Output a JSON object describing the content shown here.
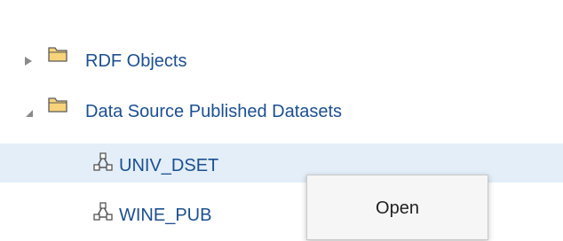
{
  "tree": {
    "items": [
      {
        "label": "RDF Objects",
        "icon": "folder-icon",
        "expanded": false
      },
      {
        "label": "Data Source Published Datasets",
        "icon": "folder-icon",
        "expanded": true
      },
      {
        "label": "UNIV_DSET",
        "icon": "dataset-icon",
        "selected": true
      },
      {
        "label": "WINE_PUB",
        "icon": "dataset-icon",
        "selected": false
      }
    ]
  },
  "context_menu": {
    "items": [
      {
        "label": "Open"
      }
    ]
  },
  "colors": {
    "link_text": "#1b4f93",
    "selection": "#e3eef8",
    "folder": "#f4c95a"
  }
}
